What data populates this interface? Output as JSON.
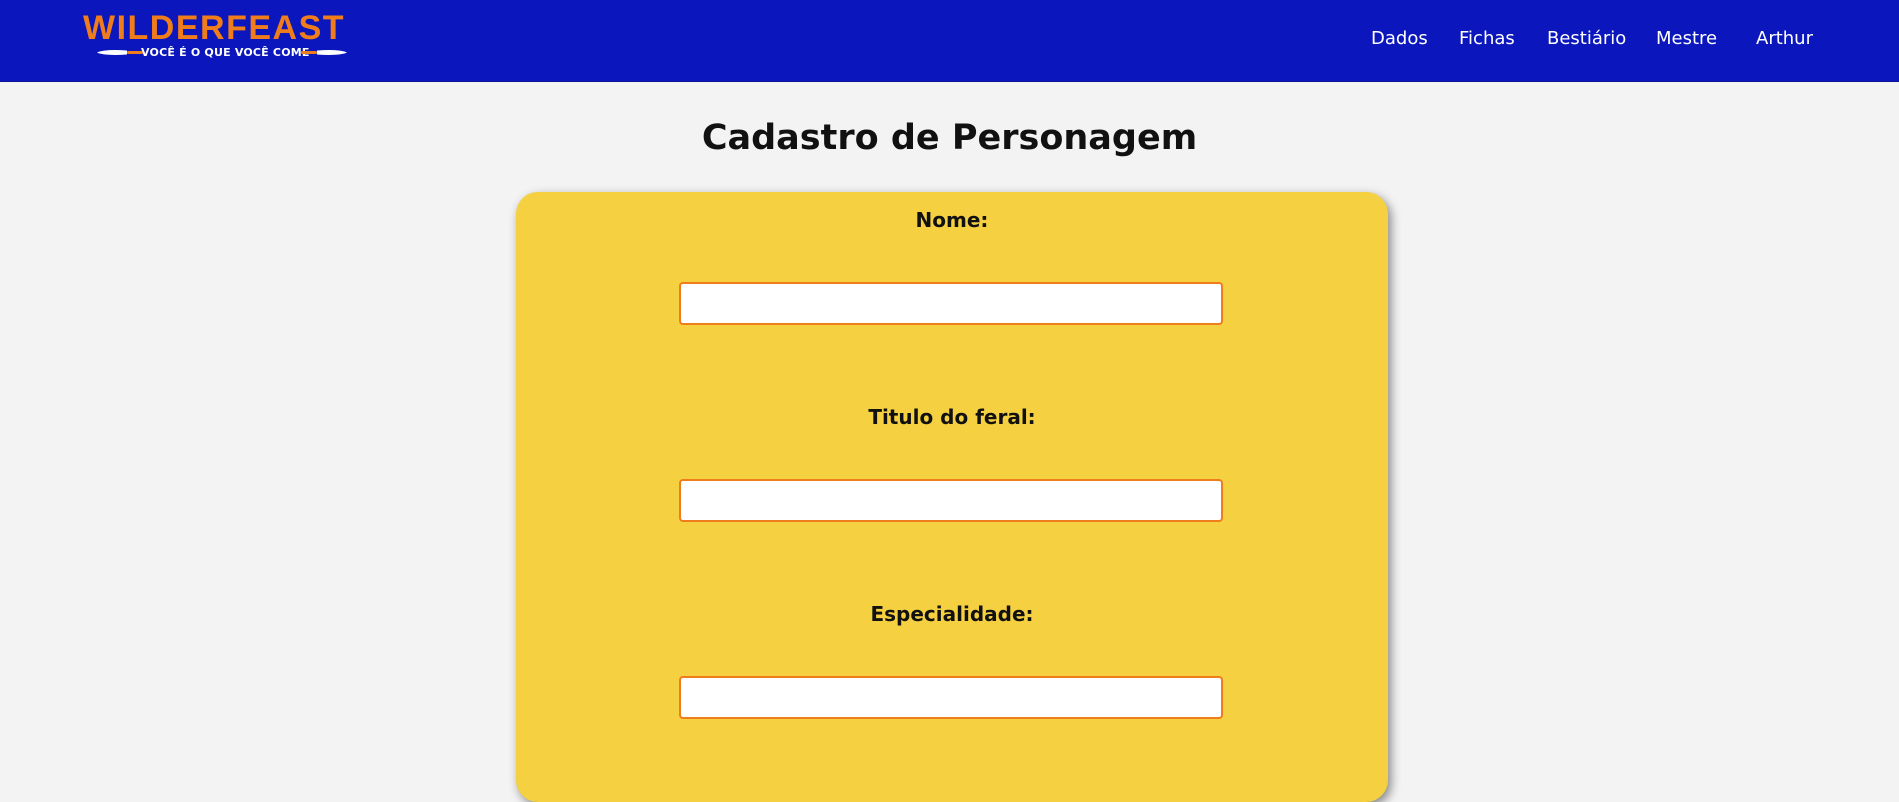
{
  "header": {
    "logo_title": "WILDERFEAST",
    "logo_tagline": "VOCÊ É O QUE VOCÊ COME",
    "nav": [
      {
        "label": "Dados"
      },
      {
        "label": "Fichas"
      },
      {
        "label": "Bestiário"
      },
      {
        "label": "Mestre"
      },
      {
        "label": "Arthur"
      }
    ]
  },
  "page": {
    "title": "Cadastro de Personagem"
  },
  "form": {
    "fields": [
      {
        "label": "Nome:",
        "value": "",
        "placeholder": ""
      },
      {
        "label": "Titulo do feral:",
        "value": "",
        "placeholder": ""
      },
      {
        "label": "Especialidade:",
        "value": "",
        "placeholder": ""
      }
    ]
  },
  "colors": {
    "navbar": "#0b17bd",
    "logo_accent": "#f07d1c",
    "card": "#f5d040",
    "page_bg": "#f3f3f3",
    "input_border": "#f07d1c"
  },
  "icons": [
    "knife-left-icon",
    "knife-right-icon"
  ]
}
